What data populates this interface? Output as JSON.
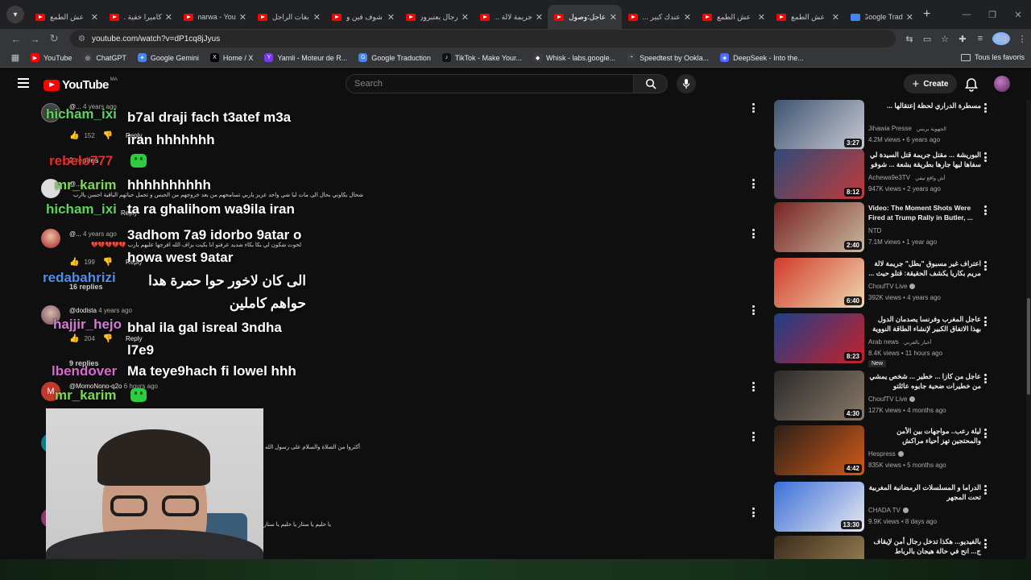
{
  "browser": {
    "tabs": [
      {
        "label": "عش الطمع",
        "active": false,
        "icon": "youtube-icon"
      },
      {
        "label": "كاميرا خفية ...",
        "active": false,
        "icon": "youtube-icon"
      },
      {
        "label": "marwa - You",
        "active": false,
        "icon": "youtube-icon"
      },
      {
        "label": "بغات الراجل",
        "active": false,
        "icon": "youtube-icon"
      },
      {
        "label": "شوف فين و",
        "active": false,
        "icon": "youtube-icon"
      },
      {
        "label": "رجال يعتبرون",
        "active": false,
        "icon": "youtube-icon"
      },
      {
        "label": "جريمة لالة ...",
        "active": false,
        "icon": "youtube-icon"
      },
      {
        "label": "عاجل:وصول",
        "active": true,
        "icon": "youtube-icon"
      },
      {
        "label": "عندك كبير ...",
        "active": false,
        "icon": "youtube-icon"
      },
      {
        "label": "عش الطمع",
        "active": false,
        "icon": "youtube-icon"
      },
      {
        "label": "عش الطمع",
        "active": false,
        "icon": "youtube-icon"
      },
      {
        "label": "Google Trad",
        "active": false,
        "icon": "google-translate-icon"
      }
    ],
    "url": "youtube.com/watch?v=dP1cq8jJyus",
    "bookmarks": [
      {
        "label": "YouTube",
        "color": "#ff0000",
        "glyph": "▶"
      },
      {
        "label": "ChatGPT",
        "color": "#3d3d3d",
        "glyph": "◎"
      },
      {
        "label": "Google Gemini",
        "color": "#4285f4",
        "glyph": "✦"
      },
      {
        "label": "Home / X",
        "color": "#000000",
        "glyph": "X"
      },
      {
        "label": "Yamli - Moteur de R...",
        "color": "#7c3aed",
        "glyph": "Y"
      },
      {
        "label": "Google Traduction",
        "color": "#4285f4",
        "glyph": "G"
      },
      {
        "label": "TikTok - Make Your...",
        "color": "#111111",
        "glyph": "♪"
      },
      {
        "label": "Whisk - labs.google...",
        "color": "#3d3d3d",
        "glyph": "◆"
      },
      {
        "label": "Speedtest by Ookla...",
        "color": "#3d3d3d",
        "glyph": "◔"
      },
      {
        "label": "DeepSeek - Into the...",
        "color": "#4d6bfe",
        "glyph": "◈"
      }
    ],
    "all_bookmarks_label": "Tous les favoris",
    "profile_initial": "Bg"
  },
  "youtube": {
    "logo_text": "YouTube",
    "region": "MA",
    "search_placeholder": "Search",
    "create_label": "Create"
  },
  "comments": [
    {
      "handle": "@...",
      "time": "4 years ago",
      "text": "",
      "likes": "152",
      "replies": "2 replies",
      "reply_label": "Reply"
    },
    {
      "handle": "@...",
      "time": "",
      "text": "شحال بكاوني بحال الى مات ليا شي واحد عزيز ياربي تسامحهم من بعد خروجهم من الحبس و تجمل حياتهم الباقية احسن ياارب",
      "likes": "",
      "replies": "",
      "reply_label": "Reply"
    },
    {
      "handle": "@...",
      "time": "4 years ago",
      "text": "لحوت شكون لي بكا بكاء شديد عرفتو انا بكيت بزاف الله افرجها عليهم يارب 💔💔💔💔💔",
      "likes": "199",
      "replies": "16 replies",
      "reply_label": "Reply"
    },
    {
      "handle": "@dodista",
      "time": "4 years ago",
      "text": "",
      "likes": "204",
      "replies": "9 replies",
      "reply_label": "Reply"
    },
    {
      "handle": "@MomoNono-q2o",
      "time": "6 hours ago",
      "text": "",
      "likes": "",
      "replies": "",
      "reply_label": ""
    },
    {
      "handle": "",
      "time": "",
      "text": "أكثروا من الصلاة والسلام على رسول الله",
      "likes": "",
      "replies": "",
      "reply_label": ""
    },
    {
      "handle": "",
      "time": "",
      "text": "يا حليم يا ستار  يا حليم يا ستار",
      "likes": "",
      "replies": "",
      "reply_label": ""
    }
  ],
  "chat_overlay": [
    {
      "user": "hicham_ixi",
      "user_color": "#5fd35f",
      "message": "b7al draji fach t3atef m3a iran hhhhhhh"
    },
    {
      "user": "rebelo777",
      "user_color": "#e0302a",
      "message": ""
    },
    {
      "user": "mr_karim",
      "user_color": "#7ed957",
      "message": "hhhhhhhhhh"
    },
    {
      "user": "hicham_ixi",
      "user_color": "#5fd35f",
      "message": "ta ra ghalihom wa9ila iran"
    },
    {
      "user": "",
      "user_color": "#ffffff",
      "message": "3adhom 7a9 idorbo 9atar o howa west 9atar"
    },
    {
      "user": "redabahrizi",
      "user_color": "#4f8fe6",
      "message": "الى كان لاخور حوا حمرة هدا حواهم كاملين"
    },
    {
      "user": "hajjir_hejo",
      "user_color": "#d67ad6",
      "message": "bhal ila gal isreal 3ndha l7e9"
    },
    {
      "user": "lbendover",
      "user_color": "#d96ad0",
      "message": "Ma teye9hach fi lowel hhh"
    },
    {
      "user": "mr_karim",
      "user_color": "#7ed957",
      "message": ""
    }
  ],
  "related": [
    {
      "title": "مسطرة الدراري لحظة إعتقالها ...",
      "channel": "Jihawia Presse",
      "channel_extra": "الجهوية بريس",
      "views": "4.2M views • 6 years ago",
      "duration": "3:27",
      "badge": "",
      "colors": [
        "#3d5470",
        "#c9c9d4"
      ],
      "verified": false
    },
    {
      "title": "البوريشة ... مقتل جريمة قتل السيدة لي سفاها ليها جارها بطريقة بشعة ... شوفو",
      "channel": "Achewa9e3TV",
      "channel_extra": "أش واقع تيفي",
      "views": "947K views • 2 years ago",
      "duration": "8:12",
      "badge": "",
      "colors": [
        "#2e4a78",
        "#c23a3a"
      ],
      "verified": false
    },
    {
      "title": "Video: The Moment Shots Were Fired at Trump Rally in Butler, ...",
      "channel": "NTD",
      "channel_extra": "",
      "views": "7.1M views • 1 year ago",
      "duration": "2:40",
      "badge": "",
      "colors": [
        "#7a2222",
        "#c8b9a0"
      ],
      "verified": false
    },
    {
      "title": "اعتراف غير مسبوق \"بطل\" جريمة لالة مريم بكاريا يكشف الحقيقة: قتلو حيث ...",
      "channel": "ChoufTV Live",
      "channel_extra": "",
      "views": "392K views • 4 years ago",
      "duration": "6:40",
      "badge": "",
      "colors": [
        "#d13a2a",
        "#f0d8b0"
      ],
      "verified": true
    },
    {
      "title": "عاجل المغرب وفرنسا يصدمان الدول بهذا الاتفاق الكبير لإنشاء الطاقة النووية - شاهد ...",
      "channel": "Arab news",
      "channel_extra": "أخبار بالعربي",
      "views": "8.4K views • 11 hours ago",
      "duration": "8:23",
      "badge": "New",
      "colors": [
        "#1c3f8a",
        "#c8202a"
      ],
      "verified": false
    },
    {
      "title": "عاجل من كازا ... خطير ... شخص يمشي من خطيرات ضحية جابوه عائلتو للسبيطار 36",
      "channel": "ChoufTV Live",
      "channel_extra": "",
      "views": "127K views • 4 months ago",
      "duration": "4:30",
      "badge": "",
      "colors": [
        "#2a2a2a",
        "#8a7a6a"
      ],
      "verified": true
    },
    {
      "title": "ليلة رعب.. مواجهات بين الأمن والمحتجين تهز أحياء مراكش",
      "channel": "Hespress",
      "channel_extra": "",
      "views": "835K views • 5 months ago",
      "duration": "4:42",
      "badge": "",
      "colors": [
        "#2b2018",
        "#d05a1a"
      ],
      "verified": true
    },
    {
      "title": "الدراما و المسلسلات الرمضانية المغربية تحت المجهر",
      "channel": "CHADA TV",
      "channel_extra": "",
      "views": "9.9K views • 8 days ago",
      "duration": "13:30",
      "badge": "",
      "colors": [
        "#3a6fd8",
        "#e8e8f0"
      ],
      "verified": true
    },
    {
      "title": "بالفيديو... هكذا تدخل رجال أمن لإيقاف ج... انح في حالة هيجان بالرباط",
      "channel": "",
      "channel_extra": "",
      "views": "",
      "duration": "",
      "badge": "",
      "colors": [
        "#3a2a1a",
        "#a08a5a"
      ],
      "verified": false
    }
  ]
}
